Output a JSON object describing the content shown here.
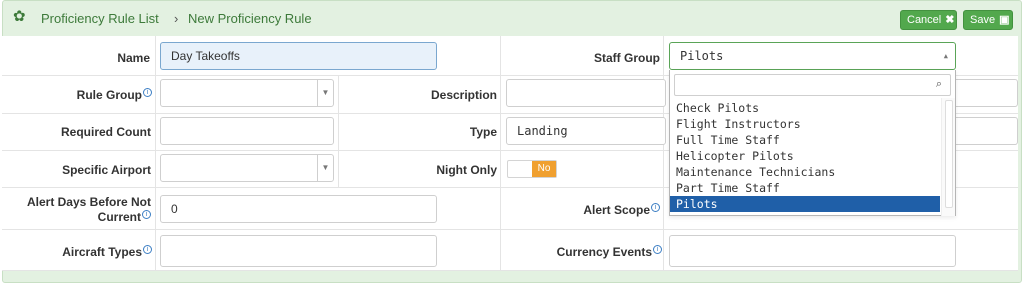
{
  "header": {
    "breadcrumb_parent": "Proficiency Rule List",
    "breadcrumb_sep": "›",
    "breadcrumb_current": "New Proficiency Rule",
    "cancel_label": "Cancel",
    "save_label": "Save"
  },
  "form": {
    "name_label": "Name",
    "name_value": "Day Takeoffs",
    "staff_group_label": "Staff Group",
    "staff_group_value": "Pilots",
    "rule_group_label": "Rule Group",
    "description_label": "Description",
    "required_count_label": "Required Count",
    "type_label": "Type",
    "type_value": "Landing",
    "specific_airport_label": "Specific Airport",
    "night_only_label": "Night Only",
    "night_only_value": "No",
    "alert_days_label_1": "Alert Days Before Not",
    "alert_days_label_2": "Current",
    "alert_days_value": "0",
    "alert_scope_label": "Alert Scope",
    "aircraft_types_label": "Aircraft Types",
    "currency_events_label": "Currency Events"
  },
  "dropdown": {
    "options": [
      "Check Pilots",
      "Flight Instructors",
      "Full Time Staff",
      "Helicopter Pilots",
      "Maintenance Technicians",
      "Part Time Staff",
      "Pilots"
    ],
    "selected": "Pilots"
  },
  "colors": {
    "header_bg": "#e3f1e1",
    "button_green": "#52a84d",
    "selected_blue": "#1f5fa8",
    "toggle_orange": "#f0a030"
  },
  "icons": {
    "help": "i"
  }
}
